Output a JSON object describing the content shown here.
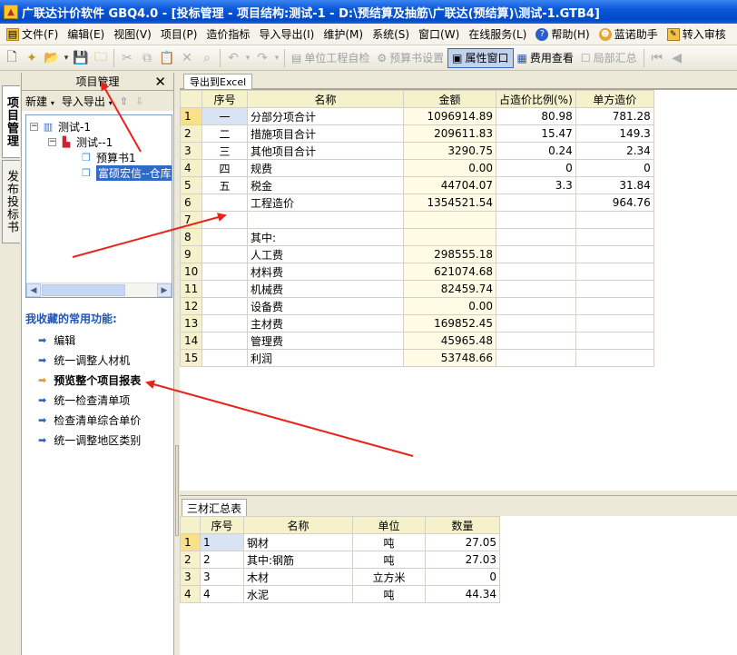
{
  "window": {
    "title": "广联达计价软件 GBQ4.0 - [投标管理 - 项目结构:测试-1 - D:\\预结算及抽筋\\广联达(预结算)\\测试-1.GTB4]"
  },
  "menu": {
    "items": [
      {
        "label": "文件(F)",
        "icon": "file-icon"
      },
      {
        "label": "编辑(E)"
      },
      {
        "label": "视图(V)"
      },
      {
        "label": "项目(P)"
      },
      {
        "label": "造价指标"
      },
      {
        "label": "导入导出(I)"
      },
      {
        "label": "维护(M)"
      },
      {
        "label": "系统(S)"
      },
      {
        "label": "窗口(W)"
      },
      {
        "label": "在线服务(L)"
      },
      {
        "label": "帮助(H)",
        "icon": "help-icon"
      },
      {
        "label": "蓝诺助手",
        "icon": "assistant-icon"
      },
      {
        "label": "转入审核",
        "icon": "review-icon"
      }
    ]
  },
  "toolbar": {
    "check_label": "单位工程自检",
    "settings_label": "预算书设置",
    "props_label": "属性窗口",
    "fees_label": "费用查看",
    "summary_label": "局部汇总"
  },
  "vtabs": {
    "project_mgmt": "项目管理",
    "publish": "发布投标书"
  },
  "left_panel": {
    "title": "项目管理",
    "new_label": "新建",
    "import_export_label": "导入导出",
    "tree": [
      {
        "label": "测试-1"
      },
      {
        "label": "测试--1"
      },
      {
        "label": "预算书1"
      },
      {
        "label": "富硕宏信--仓库"
      }
    ],
    "favorites_title": "我收藏的常用功能:",
    "favorites": [
      {
        "label": "编辑"
      },
      {
        "label": "统一调整人材机"
      },
      {
        "label": "预览整个项目报表"
      },
      {
        "label": "统一检查清单项"
      },
      {
        "label": "检查清单综合单价"
      },
      {
        "label": "统一调整地区类别"
      }
    ]
  },
  "main": {
    "tab_label": "导出到Excel",
    "columns": [
      "序号",
      "名称",
      "金额",
      "占造价比例(%)",
      "单方造价"
    ],
    "rows": [
      {
        "n": "1",
        "seq": "一",
        "name": "分部分项合计",
        "amount": "1096914.89",
        "ratio": "80.98",
        "unit": "781.28"
      },
      {
        "n": "2",
        "seq": "二",
        "name": "措施项目合计",
        "amount": "209611.83",
        "ratio": "15.47",
        "unit": "149.3"
      },
      {
        "n": "3",
        "seq": "三",
        "name": "其他项目合计",
        "amount": "3290.75",
        "ratio": "0.24",
        "unit": "2.34"
      },
      {
        "n": "4",
        "seq": "四",
        "name": "规费",
        "amount": "0.00",
        "ratio": "0",
        "unit": "0"
      },
      {
        "n": "5",
        "seq": "五",
        "name": "税金",
        "amount": "44704.07",
        "ratio": "3.3",
        "unit": "31.84"
      },
      {
        "n": "6",
        "seq": "",
        "name": "工程造价",
        "amount": "1354521.54",
        "ratio": "",
        "unit": "964.76"
      },
      {
        "n": "7",
        "seq": "",
        "name": "",
        "amount": "",
        "ratio": "",
        "unit": ""
      },
      {
        "n": "8",
        "seq": "",
        "name": "其中:",
        "amount": "",
        "ratio": "",
        "unit": ""
      },
      {
        "n": "9",
        "seq": "",
        "name": "人工费",
        "amount": "298555.18",
        "ratio": "",
        "unit": ""
      },
      {
        "n": "10",
        "seq": "",
        "name": "材料费",
        "amount": "621074.68",
        "ratio": "",
        "unit": ""
      },
      {
        "n": "11",
        "seq": "",
        "name": "机械费",
        "amount": "82459.74",
        "ratio": "",
        "unit": ""
      },
      {
        "n": "12",
        "seq": "",
        "name": "设备费",
        "amount": "0.00",
        "ratio": "",
        "unit": ""
      },
      {
        "n": "13",
        "seq": "",
        "name": "主材费",
        "amount": "169852.45",
        "ratio": "",
        "unit": ""
      },
      {
        "n": "14",
        "seq": "",
        "name": "管理费",
        "amount": "45965.48",
        "ratio": "",
        "unit": ""
      },
      {
        "n": "15",
        "seq": "",
        "name": "利润",
        "amount": "53748.66",
        "ratio": "",
        "unit": ""
      }
    ]
  },
  "materials": {
    "tab_label": "三材汇总表",
    "columns": [
      "序号",
      "名称",
      "单位",
      "数量"
    ],
    "rows": [
      {
        "n": "1",
        "seq": "1",
        "name": "钢材",
        "unit": "吨",
        "qty": "27.05"
      },
      {
        "n": "2",
        "seq": "2",
        "name": "其中:钢筋",
        "unit": "吨",
        "qty": "27.03"
      },
      {
        "n": "3",
        "seq": "3",
        "name": "木材",
        "unit": "立方米",
        "qty": "0"
      },
      {
        "n": "4",
        "seq": "4",
        "name": "水泥",
        "unit": "吨",
        "qty": "44.34"
      }
    ]
  },
  "colors": {
    "annotation_arrow": "#e8231c",
    "header_bg": "#f5f1cb",
    "selection": "#316ac5"
  }
}
